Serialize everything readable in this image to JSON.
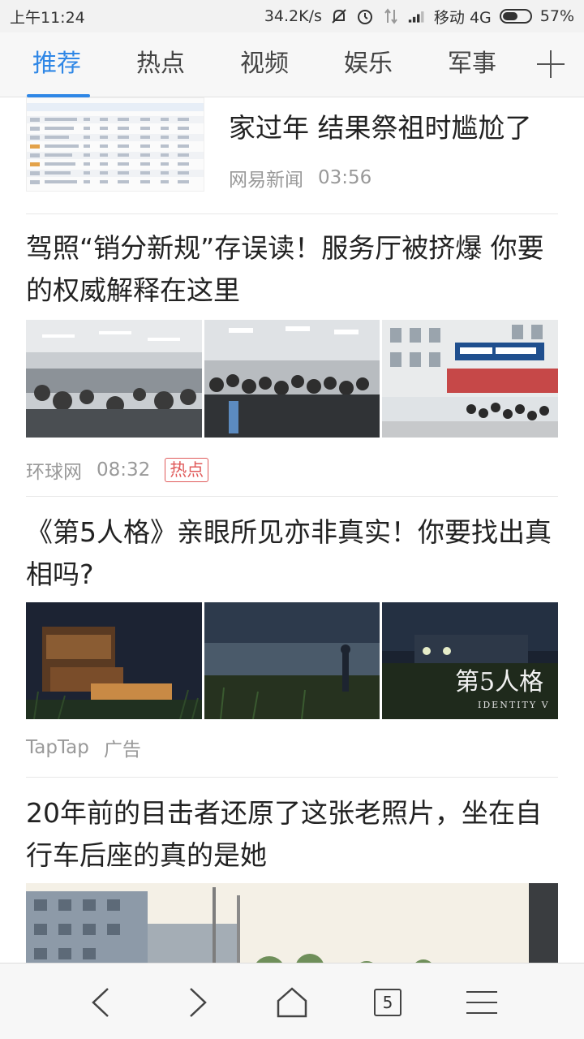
{
  "status_bar": {
    "time": "上午11:24",
    "speed": "34.2K/s",
    "carrier": "移动 4G",
    "battery_percent": "57%",
    "battery_level": 0.57,
    "icons": [
      "mute-icon",
      "alarm-icon",
      "data-arrows-icon",
      "signal-icon",
      "battery-icon"
    ]
  },
  "tabs": [
    {
      "label": "推荐",
      "active": true
    },
    {
      "label": "热点",
      "active": false
    },
    {
      "label": "视频",
      "active": false
    },
    {
      "label": "娱乐",
      "active": false
    },
    {
      "label": "军事",
      "active": false
    }
  ],
  "feed": {
    "items": [
      {
        "title_line2": "家过年 结果祭祖时尴尬了",
        "source": "网易新闻",
        "time": "03:56"
      },
      {
        "title": "驾照“销分新规”存误读！服务厅被挤爆 你要的权威解释在这里",
        "source": "环球网",
        "time": "08:32",
        "badge": "热点"
      },
      {
        "title": "《第5人格》亲眼所见亦非真实！你要找出真相吗?",
        "source": "TapTap",
        "tag": "广告",
        "logo_text": "第5人格",
        "logo_subtext": "IDENTITY V"
      },
      {
        "title": "20年前的目击者还原了这张老照片，坐在自行车后座的真的是她"
      }
    ]
  },
  "bottom_nav": {
    "tab_count": "5",
    "icons": [
      "back-icon",
      "forward-icon",
      "home-icon",
      "tabs-icon",
      "menu-icon"
    ]
  },
  "colors": {
    "accent": "#2f87e6",
    "hot_badge": "#e05b5b",
    "meta_text": "#999999"
  }
}
